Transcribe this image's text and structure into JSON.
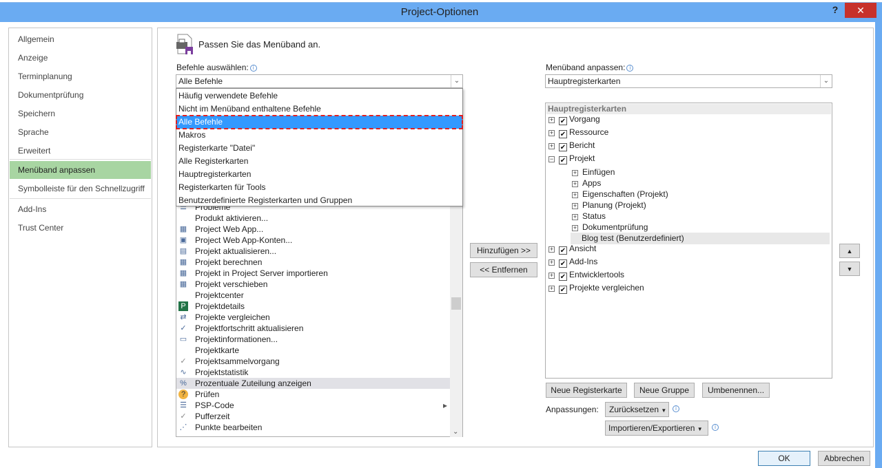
{
  "window": {
    "title": "Project-Optionen",
    "help": "?",
    "close": "✕"
  },
  "sidebar": {
    "items": [
      {
        "label": "Allgemein"
      },
      {
        "label": "Anzeige"
      },
      {
        "label": "Terminplanung"
      },
      {
        "label": "Dokumentprüfung"
      },
      {
        "label": "Speichern"
      },
      {
        "label": "Sprache"
      },
      {
        "label": "Erweitert"
      },
      {
        "label": "Menüband anpassen",
        "selected": true
      },
      {
        "label": "Symbolleiste für den Schnellzugriff"
      },
      {
        "label": "Add-Ins"
      },
      {
        "label": "Trust Center"
      }
    ]
  },
  "main": {
    "heading": "Passen Sie das Menüband an.",
    "commands_label": "Befehle auswählen:",
    "commands_value": "Alle Befehle",
    "commands_options": [
      "Häufig verwendete Befehle",
      "Nicht im Menüband enthaltene Befehle",
      "Alle Befehle",
      "Makros",
      "Registerkarte \"Datei\"",
      "Alle Registerkarten",
      "Hauptregisterkarten",
      "Registerkarten für Tools",
      "Benutzerdefinierte Registerkarten und Gruppen"
    ],
    "commands_list": [
      {
        "label": "Probleme",
        "icon": "list-icon"
      },
      {
        "label": "Produkt aktivieren...",
        "icon": ""
      },
      {
        "label": "Project Web App...",
        "icon": "web-app-icon"
      },
      {
        "label": "Project Web App-Konten...",
        "icon": "account-icon"
      },
      {
        "label": "Projekt aktualisieren...",
        "icon": "update-icon"
      },
      {
        "label": "Projekt berechnen",
        "icon": "calculate-icon"
      },
      {
        "label": "Projekt in Project Server importieren",
        "icon": "import-icon"
      },
      {
        "label": "Projekt verschieben",
        "icon": "move-icon"
      },
      {
        "label": "Projektcenter",
        "icon": ""
      },
      {
        "label": "Projektdetails",
        "icon": "project-details-icon"
      },
      {
        "label": "Projekte vergleichen",
        "icon": "compare-icon"
      },
      {
        "label": "Projektfortschritt aktualisieren",
        "icon": "progress-icon"
      },
      {
        "label": "Projektinformationen...",
        "icon": "info-icon"
      },
      {
        "label": "Projektkarte",
        "icon": ""
      },
      {
        "label": "Projektsammelvorgang",
        "icon": "check-icon"
      },
      {
        "label": "Projektstatistik",
        "icon": "statistics-icon"
      },
      {
        "label": "Prozentuale Zuteilung anzeigen",
        "icon": "allocation-icon",
        "highlighted": true
      },
      {
        "label": "Prüfen",
        "icon": "question-icon"
      },
      {
        "label": "PSP-Code",
        "icon": "wbs-icon",
        "submenu": true
      },
      {
        "label": "Pufferzeit",
        "icon": "check-icon"
      },
      {
        "label": "Punkte bearbeiten",
        "icon": "edit-points-icon"
      }
    ],
    "add_button": "Hinzufügen >>",
    "remove_button": "<< Entfernen",
    "ribbon_label": "Menüband anpassen:",
    "ribbon_value": "Hauptregisterkarten",
    "tree_header": "Hauptregisterkarten",
    "tree": [
      {
        "label": "Vorgang",
        "level": 0,
        "checked": true,
        "expanded": false
      },
      {
        "label": "Ressource",
        "level": 0,
        "checked": true,
        "expanded": false
      },
      {
        "label": "Bericht",
        "level": 0,
        "checked": true,
        "expanded": false
      },
      {
        "label": "Projekt",
        "level": 0,
        "checked": true,
        "expanded": true
      },
      {
        "label": "Einfügen",
        "level": 1
      },
      {
        "label": "Apps",
        "level": 1
      },
      {
        "label": "Eigenschaften (Projekt)",
        "level": 1
      },
      {
        "label": "Planung (Projekt)",
        "level": 1
      },
      {
        "label": "Status",
        "level": 1
      },
      {
        "label": "Dokumentprüfung",
        "level": 1
      },
      {
        "label": "Blog test (Benutzerdefiniert)",
        "level": 1,
        "leaf": true,
        "selected": true
      },
      {
        "label": "Ansicht",
        "level": 0,
        "checked": true,
        "expanded": false
      },
      {
        "label": "Add-Ins",
        "level": 0,
        "checked": true,
        "expanded": false
      },
      {
        "label": "Entwicklertools",
        "level": 0,
        "checked": true,
        "expanded": false
      },
      {
        "label": "Projekte vergleichen",
        "level": 0,
        "checked": true,
        "expanded": false
      }
    ],
    "new_tab_button": "Neue Registerkarte",
    "new_group_button": "Neue Gruppe",
    "rename_button": "Umbenennen...",
    "customizations_label": "Anpassungen:",
    "reset_button": "Zurücksetzen",
    "import_export_button": "Importieren/Exportieren"
  },
  "footer": {
    "ok": "OK",
    "cancel": "Abbrechen"
  },
  "colors": {
    "titlebar": "#6aabf2",
    "selected_nav": "#a8d5a2",
    "selection": "#3399ff",
    "close": "#c7312b"
  }
}
